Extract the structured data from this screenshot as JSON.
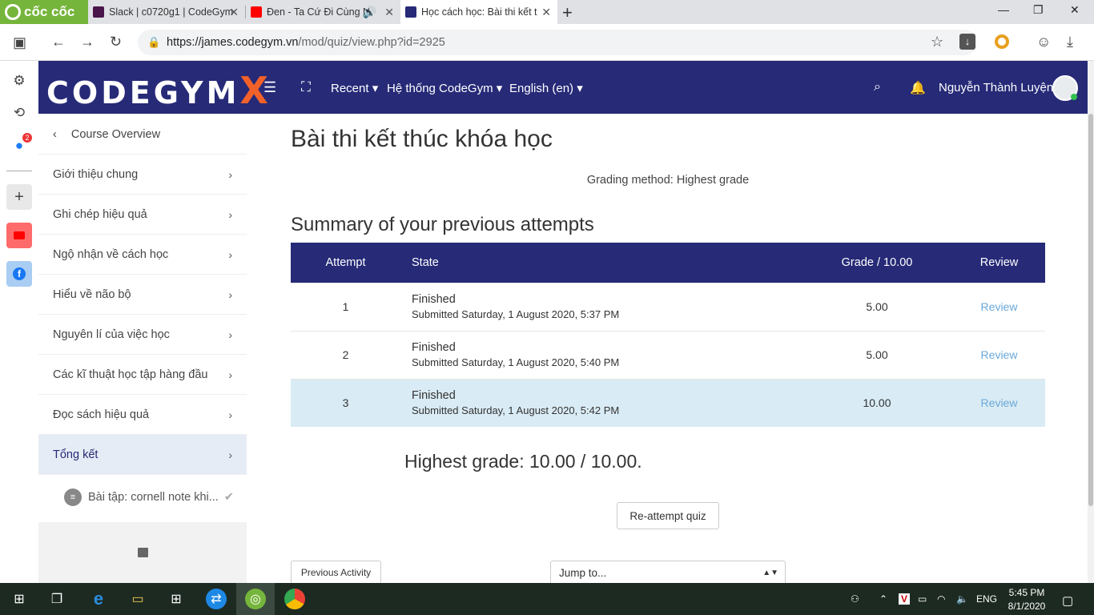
{
  "browser": {
    "brand": "cốc cốc",
    "tabs": [
      {
        "title": "Slack | c0720g1 | CodeGym",
        "color": "#4a154b"
      },
      {
        "title": "Đen - Ta Cứ Đi Cùng N",
        "color": "#ff0000"
      },
      {
        "title": "Học cách học: Bài thi kết t",
        "color": "#262a77"
      }
    ],
    "new_tab": "+",
    "url_host": "https://james.codegym.vn",
    "url_path": "/mod/quiz/view.php?id=2925",
    "messenger_badge": "2"
  },
  "navbar": {
    "brand": "CODEGYM",
    "brand_x": "X",
    "items": [
      "Recent",
      "Hệ thống CodeGym",
      "English (en)"
    ],
    "user": "Nguyễn Thành Luyện"
  },
  "drawer": {
    "back": "Course Overview",
    "items": [
      "Giới thiệu chung",
      "Ghi chép hiệu quả",
      "Ngộ nhận về cách học",
      "Hiểu về não bộ",
      "Nguyên lí của việc học",
      "Các kĩ thuật học tập hàng đầu",
      "Đọc sách hiệu quả",
      "Tổng kết"
    ],
    "sub_item": "Bài tập: cornell note khi..."
  },
  "main": {
    "title": "Bài thi kết thúc khóa học",
    "grading": "Grading method: Highest grade",
    "summary_title": "Summary of your previous attempts",
    "table": {
      "headers": [
        "Attempt",
        "State",
        "Grade / 10.00",
        "Review"
      ],
      "rows": [
        {
          "attempt": "1",
          "state": "Finished",
          "submitted": "Submitted Saturday, 1 August 2020, 5:37 PM",
          "grade": "5.00",
          "review": "Review"
        },
        {
          "attempt": "2",
          "state": "Finished",
          "submitted": "Submitted Saturday, 1 August 2020, 5:40 PM",
          "grade": "5.00",
          "review": "Review"
        },
        {
          "attempt": "3",
          "state": "Finished",
          "submitted": "Submitted Saturday, 1 August 2020, 5:42 PM",
          "grade": "10.00",
          "review": "Review"
        }
      ]
    },
    "highest": "Highest grade: 10.00 / 10.00.",
    "reattempt": "Re-attempt quiz",
    "prev_activity": "Previous Activity",
    "jump_to": "Jump to..."
  },
  "taskbar": {
    "lang": "ENG",
    "time": "5:45 PM",
    "date": "8/1/2020"
  }
}
